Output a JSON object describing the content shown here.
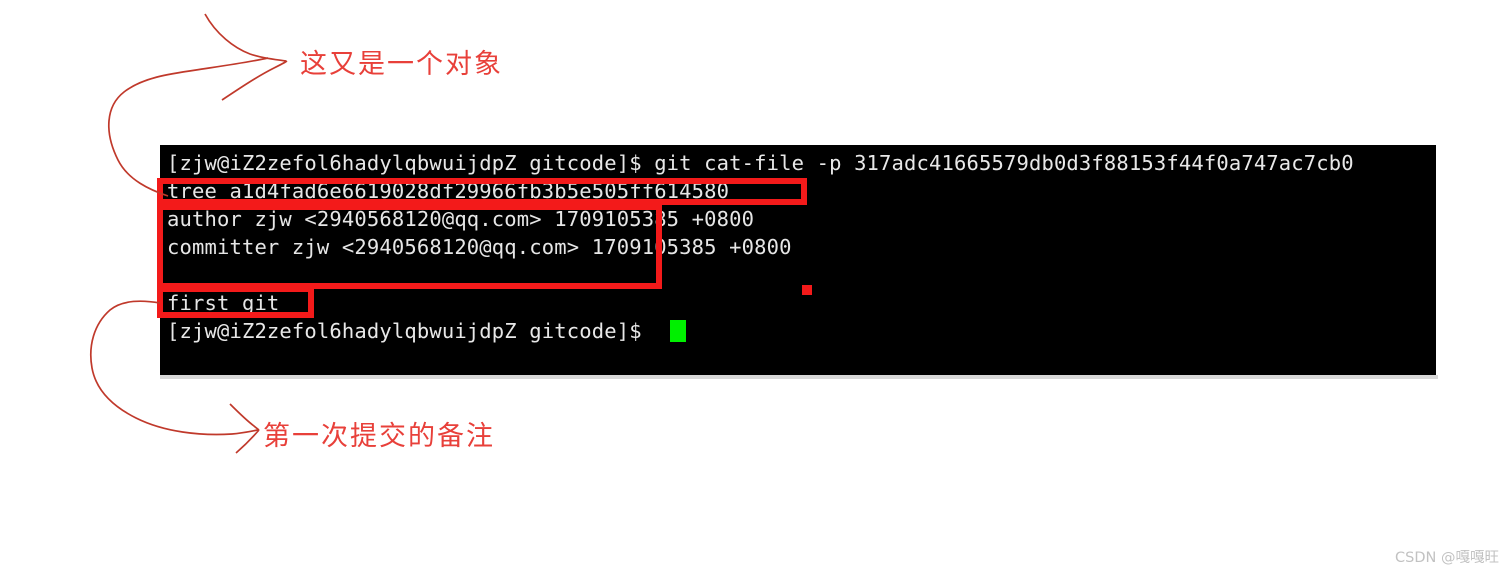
{
  "terminal": {
    "prompt": "[zjw@iZ2zefol6hadylqbwuijdpZ gitcode]$",
    "lines": [
      {
        "type": "command",
        "prompt": "[zjw@iZ2zefol6hadylqbwuijdpZ gitcode]$",
        "command": " git cat-file -p 317adc41665579db0d3f88153f44f0a747ac7cb0"
      },
      {
        "type": "output",
        "text": "tree a1d4fad6e6619028df29966fb3b5e505ff614580"
      },
      {
        "type": "output",
        "text": "author zjw <2940568120@qq.com> 1709105385 +0800"
      },
      {
        "type": "output",
        "text": "committer zjw <2940568120@qq.com> 1709105385 +0800"
      },
      {
        "type": "output",
        "text": ""
      },
      {
        "type": "output",
        "text": "first git"
      },
      {
        "type": "prompt",
        "prompt": "[zjw@iZ2zefol6hadylqbwuijdpZ gitcode]$",
        "command": ""
      }
    ],
    "command_text": " git cat-file -p 317adc41665579db0d3f88153f44f0a747ac7cb0",
    "tree_line": "tree a1d4fad6e6619028df29966fb3b5e505ff614580",
    "author_line": "author zjw <2940568120@qq.com> 1709105385 +0800",
    "committer_line": "committer zjw <2940568120@qq.com> 1709105385 +0800",
    "message_line": "first git",
    "commit_hash": "317adc41665579db0d3f88153f44f0a747ac7cb0",
    "tree_hash": "a1d4fad6e6619028df29966fb3b5e505ff614580",
    "author_email": "2940568120@qq.com",
    "timestamp": "1709105385 +0800",
    "cursor_color": "#00f000",
    "background_color": "#000000",
    "text_color": "#e6e6e6"
  },
  "annotations": {
    "top_label": "这又是一个对象",
    "bottom_label": "第一次提交的备注",
    "highlight_color": "#f31a1a",
    "text_color": "#e8403a",
    "boxes": [
      {
        "name": "tree-line-box",
        "target": "tree a1d4fad6e6619028df29966fb3b5e505ff614580"
      },
      {
        "name": "author-committer-box",
        "target": "author / committer lines"
      },
      {
        "name": "commit-message-box",
        "target": "first git"
      }
    ]
  },
  "watermark": {
    "text": "CSDN @嘎嘎旺",
    "color": "#c2c2c2"
  }
}
